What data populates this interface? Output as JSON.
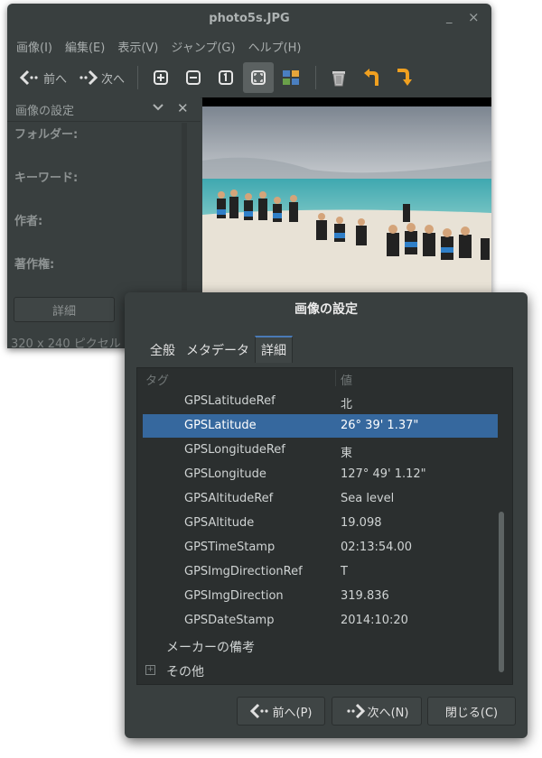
{
  "window": {
    "title": "photo5s.JPG",
    "min": "_",
    "close": "×"
  },
  "menu": [
    "画像(I)",
    "編集(E)",
    "表示(V)",
    "ジャンプ(G)",
    "ヘルプ(H)"
  ],
  "toolbar": {
    "prev_label": "前へ",
    "next_label": "次へ"
  },
  "side_panel": {
    "title": "画像の設定",
    "fields": [
      "フォルダー:",
      "キーワード:",
      "作者:",
      "著作権:"
    ],
    "detail_button": "詳細",
    "status": "320 x 240 ピクセル"
  },
  "dialog": {
    "title": "画像の設定",
    "tabs": [
      "全般",
      "メタデータ",
      "詳細"
    ],
    "active_tab": 2,
    "columns": {
      "tag": "タグ",
      "value": "値"
    },
    "rows": [
      {
        "tag": "GPSLatitudeRef",
        "value": "北"
      },
      {
        "tag": "GPSLatitude",
        "value": "26° 39' 1.37\""
      },
      {
        "tag": "GPSLongitudeRef",
        "value": "東"
      },
      {
        "tag": "GPSLongitude",
        "value": "127° 49' 1.12\""
      },
      {
        "tag": "GPSAltitudeRef",
        "value": "Sea level"
      },
      {
        "tag": "GPSAltitude",
        "value": "19.098"
      },
      {
        "tag": "GPSTimeStamp",
        "value": "02:13:54.00"
      },
      {
        "tag": "GPSImgDirectionRef",
        "value": "T"
      },
      {
        "tag": "GPSImgDirection",
        "value": "319.836"
      },
      {
        "tag": "GPSDateStamp",
        "value": "2014:10:20"
      }
    ],
    "selected_row": 1,
    "groups": [
      {
        "label": "メーカーの備考",
        "expander": ""
      },
      {
        "label": "その他",
        "expander": "+"
      }
    ],
    "buttons": {
      "prev": "前へ(P)",
      "next": "次へ(N)",
      "close": "閉じる(C)"
    }
  },
  "colors": {
    "selection": "#36689e",
    "accent_arrow": "#f0a020",
    "background": "#393f3f"
  }
}
